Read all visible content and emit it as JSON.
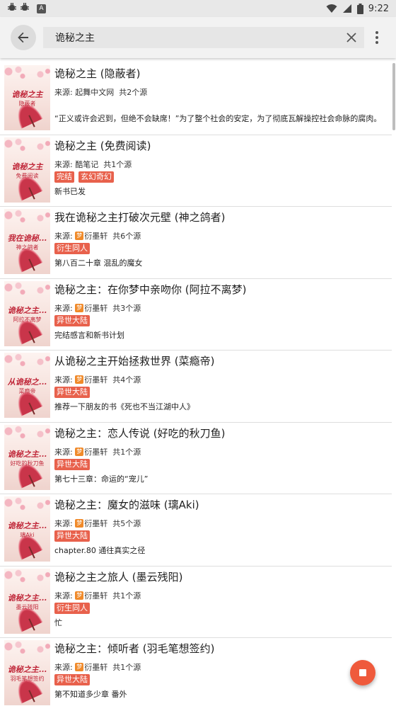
{
  "status_bar": {
    "time": "9:22",
    "left_icons": [
      "bug-icon",
      "bug-icon",
      "a-icon"
    ],
    "right_icons": [
      "wifi-icon",
      "signal-icon",
      "battery-icon"
    ]
  },
  "app_bar": {
    "search_value": "诡秘之主",
    "icons": [
      "back-arrow-icon",
      "clear-icon",
      "more-vert-icon"
    ]
  },
  "books": [
    {
      "title": "诡秘之主 (隐蔽者)",
      "source": "来源: 起舞中文网  共2个源",
      "source_icon": false,
      "tags": [],
      "latest": "“正义或许会迟到，但绝不会缺席！”为了整个社会的安定，为了彻底瓦解操控社会命脉的腐肉。",
      "cover_title": "诡秘之主",
      "cover_author": "隐蔽者"
    },
    {
      "title": "诡秘之主 (免费阅读)",
      "source": "来源: 酷笔记  共1个源",
      "source_icon": false,
      "tags": [
        "完结",
        "玄幻奇幻"
      ],
      "latest": "新书已发",
      "cover_title": "诡秘之主",
      "cover_author": "免费阅读"
    },
    {
      "title": "我在诡秘之主打破次元壁 (神之鸽者)",
      "source": "衍墨轩  共6个源",
      "source_icon": true,
      "tags": [
        "衍生同人"
      ],
      "latest": "第八百二十章 混乱的魔女",
      "cover_title": "我在诡秘...",
      "cover_author": "神之鸽者"
    },
    {
      "title": "诡秘之主：在你梦中亲吻你 (阿拉不离梦)",
      "source": "衍墨轩  共3个源",
      "source_icon": true,
      "tags": [
        "异世大陆"
      ],
      "latest": "完结感言和新书计划",
      "cover_title": "诡秘之主...",
      "cover_author": "阿拉不离梦"
    },
    {
      "title": "从诡秘之主开始拯救世界 (菜瘾帝)",
      "source": "衍墨轩  共4个源",
      "source_icon": true,
      "tags": [
        "异世大陆"
      ],
      "latest": "推荐一下朋友的书《死也不当江湖中人》",
      "cover_title": "从诡秘之...",
      "cover_author": "菜瘾帝"
    },
    {
      "title": "诡秘之主：恋人传说 (好吃的秋刀鱼)",
      "source": "衍墨轩  共1个源",
      "source_icon": true,
      "tags": [
        "异世大陆"
      ],
      "latest": "第七十三章：命运的“宠儿”",
      "cover_title": "诡秘之主...",
      "cover_author": "好吃的秋刀鱼"
    },
    {
      "title": "诡秘之主：魔女的滋味 (璃Aki)",
      "source": "衍墨轩  共5个源",
      "source_icon": true,
      "tags": [
        "异世大陆"
      ],
      "latest": "chapter.80 通往真实之径",
      "cover_title": "诡秘之主...",
      "cover_author": "璃Aki"
    },
    {
      "title": "诡秘之主之旅人 (墨云残阳)",
      "source": "衍墨轩  共1个源",
      "source_icon": true,
      "tags": [
        "衍生同人"
      ],
      "latest": "忙",
      "cover_title": "诡秘之主...",
      "cover_author": "墨云残阳"
    },
    {
      "title": "诡秘之主：倾听者 (羽毛笔想签约)",
      "source": "衍墨轩  共1个源",
      "source_icon": true,
      "tags": [
        "异世大陆"
      ],
      "latest": "第不知道多少章 番外",
      "cover_title": "诡秘之主...",
      "cover_author": "羽毛笔想签约"
    }
  ],
  "source_prefix": "来源: ",
  "source_site_glyph": "梦",
  "fab": {
    "icon": "stop-icon"
  },
  "colors": {
    "tag_bg": "#e8614c",
    "fab_bg": "#ef5a3c",
    "app_bar_bg": "#f2f2f2",
    "status_bar_bg": "#e8e8e8"
  }
}
